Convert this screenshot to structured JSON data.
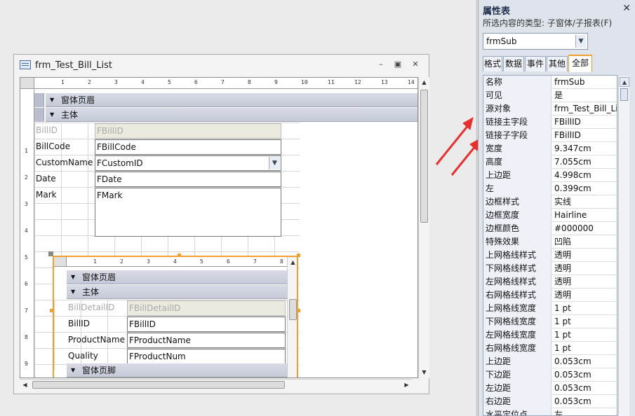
{
  "form_window": {
    "title": "frm_Test_Bill_List",
    "minimize": "–",
    "restore": "▣",
    "close": "✕",
    "ruler_marks": [
      "1",
      "2",
      "3",
      "4",
      "5",
      "6",
      "7",
      "8",
      "9",
      "10",
      "11",
      "12",
      "13",
      "14"
    ],
    "vruler_marks": [
      "1",
      "2",
      "3",
      "4",
      "5",
      "6",
      "7",
      "8",
      "9"
    ],
    "header_band": "窗体页眉",
    "detail_band": "主体",
    "fields": [
      {
        "label": "BillID",
        "control": "FBillID",
        "dim": true
      },
      {
        "label": "BillCode",
        "control": "FBillCode",
        "dim": false
      },
      {
        "label": "CustomName",
        "control": "FCustomID",
        "dim": false,
        "combo": true
      },
      {
        "label": "Date",
        "control": "FDate",
        "dim": false
      },
      {
        "label": "Mark",
        "control": "FMark",
        "dim": false
      }
    ]
  },
  "subform": {
    "ruler_marks": [
      "1",
      "2",
      "3",
      "4",
      "5",
      "6",
      "7",
      "8"
    ],
    "header_band": "窗体页眉",
    "detail_band": "主体",
    "footer_band": "窗体页脚",
    "fields": [
      {
        "label": "BillDetailID",
        "control": "FBillDetailID",
        "dim": true
      },
      {
        "label": "BillID",
        "control": "FBillID",
        "dim": false
      },
      {
        "label": "ProductName",
        "control": "FProductName",
        "dim": false
      },
      {
        "label": "Quality",
        "control": "FProductNum",
        "dim": false
      }
    ]
  },
  "property_sheet": {
    "title": "属性表",
    "close": "✕",
    "selection_type": "所选内容的类型: 子窗体/子报表(F)",
    "selected_object": "frmSub",
    "tabs": [
      "格式",
      "数据",
      "事件",
      "其他",
      "全部"
    ],
    "active_tab": "全部",
    "rows": [
      {
        "k": "名称",
        "v": "frmSub"
      },
      {
        "k": "可见",
        "v": "是"
      },
      {
        "k": "源对象",
        "v": "frm_Test_Bill_List"
      },
      {
        "k": "链接主字段",
        "v": "FBillID"
      },
      {
        "k": "链接子字段",
        "v": "FBillID"
      },
      {
        "k": "宽度",
        "v": "9.347cm"
      },
      {
        "k": "高度",
        "v": "7.055cm"
      },
      {
        "k": "上边距",
        "v": "4.998cm"
      },
      {
        "k": "左",
        "v": "0.399cm"
      },
      {
        "k": "边框样式",
        "v": "实线"
      },
      {
        "k": "边框宽度",
        "v": "Hairline"
      },
      {
        "k": "边框颜色",
        "v": "#000000"
      },
      {
        "k": "特殊效果",
        "v": "凹陷"
      },
      {
        "k": "上网格线样式",
        "v": "透明"
      },
      {
        "k": "下网格线样式",
        "v": "透明"
      },
      {
        "k": "左网格线样式",
        "v": "透明"
      },
      {
        "k": "右网格线样式",
        "v": "透明"
      },
      {
        "k": "上网格线宽度",
        "v": "1 pt"
      },
      {
        "k": "下网格线宽度",
        "v": "1 pt"
      },
      {
        "k": "左网格线宽度",
        "v": "1 pt"
      },
      {
        "k": "右网格线宽度",
        "v": "1 pt"
      },
      {
        "k": "上边距",
        "v": "0.053cm"
      },
      {
        "k": "下边距",
        "v": "0.053cm"
      },
      {
        "k": "左边距",
        "v": "0.053cm"
      },
      {
        "k": "右边距",
        "v": "0.053cm"
      },
      {
        "k": "水平定位点",
        "v": "左"
      }
    ]
  },
  "colors": {
    "accent": "#f0a030",
    "annotation_arrow": "#e53030"
  }
}
